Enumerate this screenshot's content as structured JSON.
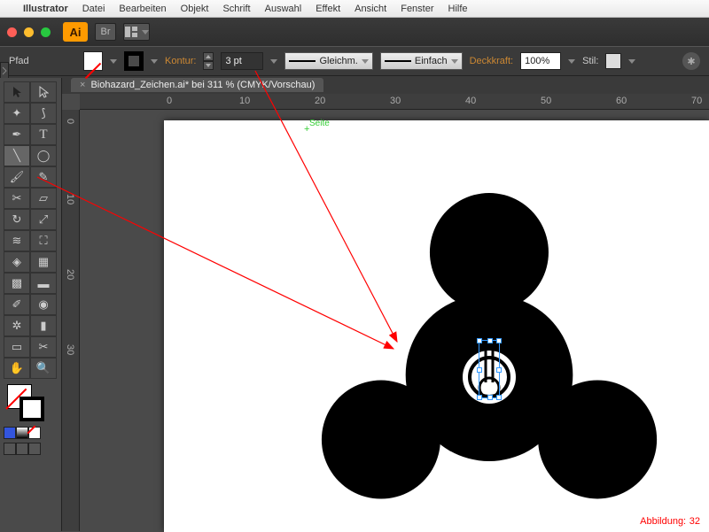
{
  "menu": {
    "app": "Illustrator",
    "items": [
      "Datei",
      "Bearbeiten",
      "Objekt",
      "Schrift",
      "Auswahl",
      "Effekt",
      "Ansicht",
      "Fenster",
      "Hilfe"
    ]
  },
  "traffic": {
    "close": "#ff5f57",
    "min": "#ffbd2e",
    "max": "#28c940"
  },
  "badge": "Ai",
  "titlebar_btn": "Br",
  "ctrl": {
    "label": "Pfad",
    "kontur_label": "Kontur:",
    "stroke_value": "3 pt",
    "profile": "Gleichm.",
    "brush": "Einfach",
    "opacity_label": "Deckkraft:",
    "opacity_value": "100%",
    "stil_label": "Stil:"
  },
  "doc": {
    "close": "×",
    "title": "Biohazard_Zeichen.ai* bei 311 % (CMYK/Vorschau)"
  },
  "ruler_h": [
    "0",
    "10",
    "20",
    "30",
    "40",
    "50",
    "60",
    "70"
  ],
  "ruler_v": [
    "0",
    "10",
    "20",
    "30"
  ],
  "page_label": "Seite",
  "annotation": {
    "label": "Abbildung:",
    "number": "32"
  },
  "colors": {
    "accent": "#ff9a00",
    "annot": "#ff0000",
    "sel": "#3399ff"
  }
}
